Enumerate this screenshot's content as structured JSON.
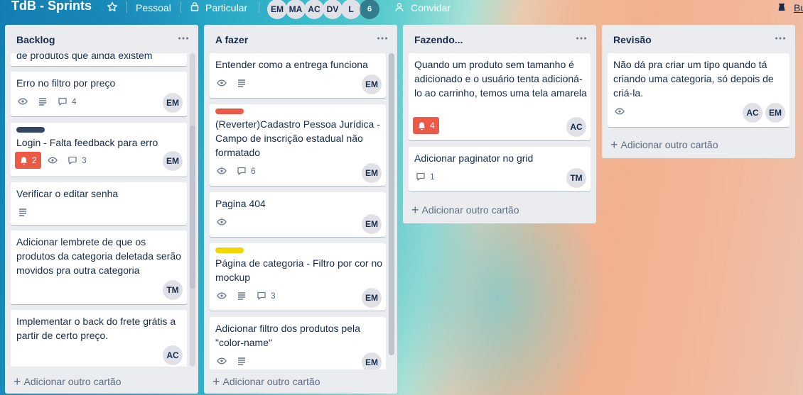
{
  "header": {
    "board_title": "TdB - Sprints",
    "team": "Pessoal",
    "visibility": "Particular",
    "members": [
      "EM",
      "MA",
      "AC",
      "DV",
      "L"
    ],
    "member_overflow": "6",
    "invite": "Convidar",
    "butler": "Bu"
  },
  "lists": [
    {
      "title": "Backlog",
      "cards": [
        {
          "title": "de produtos que ainda existem"
        },
        {
          "title": "Erro no filtro por preço",
          "comments": "4",
          "member": "EM"
        },
        {
          "title": "Login - Falta feedback para erro",
          "label_color": "#344563",
          "alerts": "2",
          "comments": "3",
          "member": "EM"
        },
        {
          "title": "Verificar o editar senha"
        },
        {
          "title": "Adicionar lembrete de que os produtos da categoria deletada serão movidos pra outra categoria",
          "member": "TM"
        },
        {
          "title": "Implementar o back do frete grátis a partir de certo preço.",
          "member": "AC"
        }
      ],
      "add_card": "Adicionar outro cartão"
    },
    {
      "title": "A fazer",
      "cards": [
        {
          "title": "Entender como a entrega funciona",
          "member": "EM"
        },
        {
          "title": "(Reverter)Cadastro Pessoa Jurídica - Campo de inscrição estadual não formatado",
          "label_color": "#eb5a46",
          "comments": "6",
          "member": "EM"
        },
        {
          "title": "Pagina 404",
          "member": "EM"
        },
        {
          "title": "Página de categoria - Filtro por cor no mockup",
          "label_color": "#f2d600",
          "comments": "3",
          "member": "EM"
        },
        {
          "title": "Adicionar filtro dos produtos pela \"color-name\"",
          "member": "EM"
        }
      ],
      "add_card": "Adicionar outro cartão"
    },
    {
      "title": "Fazendo...",
      "cards": [
        {
          "title": "Quando um produto sem tamanho é adicionado e o usuário tenta adicioná-lo ao carrinho, temos uma tela amarela",
          "alerts": "4",
          "member": "AC"
        },
        {
          "title": "Adicionar paginator no grid",
          "comments": "1",
          "member": "TM"
        }
      ],
      "add_card": "Adicionar outro cartão"
    },
    {
      "title": "Revisão",
      "cards": [
        {
          "title": "Não dá pra criar um tipo quando tá criando uma categoria, só depois de criá-la.",
          "members": [
            "AC",
            "EM"
          ]
        }
      ],
      "add_card": "Adicionar outro cartão"
    }
  ]
}
